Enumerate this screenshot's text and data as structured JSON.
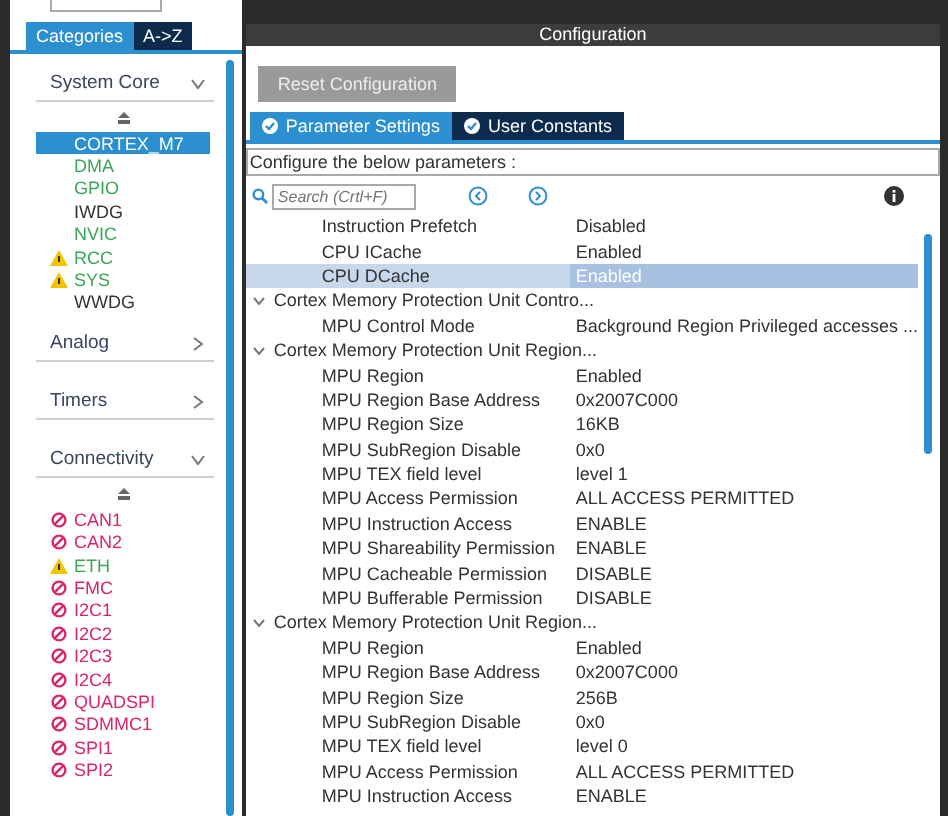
{
  "sidebar": {
    "tabs": [
      {
        "label": "Categories",
        "selected": true
      },
      {
        "label": "A->Z",
        "selected": false
      }
    ],
    "categories": [
      {
        "label": "System Core",
        "expanded": true,
        "items": [
          {
            "label": "CORTEX_M7",
            "kind": "plain",
            "selected": true
          },
          {
            "label": "DMA",
            "kind": "ok",
            "selected": false
          },
          {
            "label": "GPIO",
            "kind": "ok",
            "selected": false
          },
          {
            "label": "IWDG",
            "kind": "plain",
            "selected": false
          },
          {
            "label": "NVIC",
            "kind": "ok",
            "selected": false
          },
          {
            "label": "RCC",
            "kind": "warning",
            "selected": false
          },
          {
            "label": "SYS",
            "kind": "warning",
            "selected": false
          },
          {
            "label": "WWDG",
            "kind": "plain",
            "selected": false
          }
        ]
      },
      {
        "label": "Analog",
        "expanded": false
      },
      {
        "label": "Timers",
        "expanded": false
      },
      {
        "label": "Connectivity",
        "expanded": true,
        "items": [
          {
            "label": "CAN1",
            "kind": "blocked",
            "selected": false
          },
          {
            "label": "CAN2",
            "kind": "blocked",
            "selected": false
          },
          {
            "label": "ETH",
            "kind": "warning",
            "selected": false
          },
          {
            "label": "FMC",
            "kind": "blocked",
            "selected": false
          },
          {
            "label": "I2C1",
            "kind": "blocked",
            "selected": false
          },
          {
            "label": "I2C2",
            "kind": "blocked",
            "selected": false
          },
          {
            "label": "I2C3",
            "kind": "blocked",
            "selected": false
          },
          {
            "label": "I2C4",
            "kind": "blocked",
            "selected": false
          },
          {
            "label": "QUADSPI",
            "kind": "blocked",
            "selected": false
          },
          {
            "label": "SDMMC1",
            "kind": "blocked",
            "selected": false
          },
          {
            "label": "SPI1",
            "kind": "blocked",
            "selected": false
          },
          {
            "label": "SPI2",
            "kind": "blocked",
            "selected": false
          }
        ]
      }
    ]
  },
  "configuration": {
    "title": "Configuration",
    "reset_button": "Reset Configuration",
    "tabs": [
      {
        "label": "Parameter Settings",
        "selected": true
      },
      {
        "label": "User Constants",
        "selected": false
      }
    ],
    "hint": "Configure the below parameters :",
    "search": {
      "placeholder": "Search (Crtl+F)"
    },
    "parameters": [
      {
        "kind": "row",
        "name": "Instruction Prefetch",
        "value": "Disabled",
        "selected": false
      },
      {
        "kind": "row",
        "name": "CPU ICache",
        "value": "Enabled",
        "selected": false
      },
      {
        "kind": "row",
        "name": "CPU DCache",
        "value": "Enabled",
        "selected": true
      },
      {
        "kind": "group",
        "label": "Cortex Memory Protection Unit Contro...",
        "expanded": true,
        "children": [
          {
            "kind": "row",
            "name": "MPU Control Mode",
            "value": "Background Region Privileged accesses ...",
            "selected": false
          }
        ]
      },
      {
        "kind": "group",
        "label": "Cortex Memory Protection Unit Region...",
        "expanded": true,
        "children": [
          {
            "kind": "row",
            "name": "MPU Region",
            "value": "Enabled",
            "selected": false
          },
          {
            "kind": "row",
            "name": "MPU Region Base Address",
            "value": "0x2007C000",
            "selected": false
          },
          {
            "kind": "row",
            "name": "MPU Region Size",
            "value": "16KB",
            "selected": false
          },
          {
            "kind": "row",
            "name": "MPU SubRegion Disable",
            "value": "0x0",
            "selected": false
          },
          {
            "kind": "row",
            "name": "MPU TEX field level",
            "value": "level 1",
            "selected": false
          },
          {
            "kind": "row",
            "name": "MPU Access Permission",
            "value": "ALL ACCESS PERMITTED",
            "selected": false
          },
          {
            "kind": "row",
            "name": "MPU Instruction Access",
            "value": "ENABLE",
            "selected": false
          },
          {
            "kind": "row",
            "name": "MPU Shareability Permission",
            "value": "ENABLE",
            "selected": false
          },
          {
            "kind": "row",
            "name": "MPU Cacheable Permission",
            "value": "DISABLE",
            "selected": false
          },
          {
            "kind": "row",
            "name": "MPU Bufferable  Permission",
            "value": "DISABLE",
            "selected": false
          }
        ]
      },
      {
        "kind": "group",
        "label": "Cortex Memory Protection Unit Region...",
        "expanded": true,
        "children": [
          {
            "kind": "row",
            "name": "MPU Region",
            "value": "Enabled",
            "selected": false
          },
          {
            "kind": "row",
            "name": "MPU Region Base Address",
            "value": "0x2007C000",
            "selected": false
          },
          {
            "kind": "row",
            "name": "MPU Region Size",
            "value": "256B",
            "selected": false
          },
          {
            "kind": "row",
            "name": "MPU SubRegion Disable",
            "value": "0x0",
            "selected": false
          },
          {
            "kind": "row",
            "name": "MPU TEX field level",
            "value": "level 0",
            "selected": false
          },
          {
            "kind": "row",
            "name": "MPU Access Permission",
            "value": "ALL ACCESS PERMITTED",
            "selected": false
          },
          {
            "kind": "row",
            "name": "MPU Instruction Access",
            "value": "ENABLE",
            "selected": false
          }
        ]
      }
    ]
  }
}
